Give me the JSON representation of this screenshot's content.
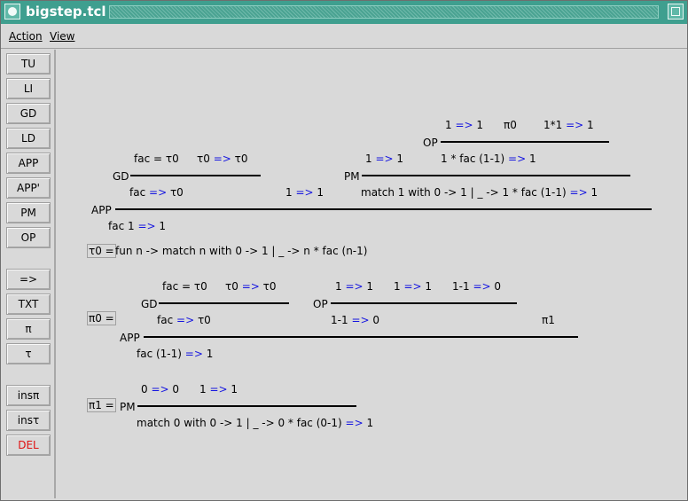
{
  "window": {
    "title": "bigstep.tcl"
  },
  "menu": {
    "action": "Action",
    "view": "View"
  },
  "toolbar": [
    "TU",
    "LI",
    "GD",
    "LD",
    "APP",
    "APP'",
    "PM",
    "OP",
    "=>",
    "TXT",
    "π",
    "τ",
    "insπ",
    "insτ",
    "DEL"
  ],
  "arrow": "=>",
  "main": {
    "op_top": {
      "a": "1",
      "b": "1",
      "pi0": "π0",
      "c": "1*1",
      "d": "1",
      "label": "OP"
    },
    "gd1": {
      "prem1_left": "fac = τ0",
      "prem2_a": "τ0",
      "prem2_b": "τ0",
      "label": "GD",
      "concl_a": "fac",
      "concl_b": "τ0"
    },
    "pm1": {
      "prem1_a": "1",
      "prem1_b": "1",
      "prem2_a": "1 * fac (1-1)",
      "prem2_b": "1",
      "label": "PM",
      "mid_a": "1",
      "mid_b": "1",
      "concl_a": "match 1 with 0 -> 1 | _ -> 1 * fac (1-1)",
      "concl_b": "1"
    },
    "app": {
      "label": "APP",
      "concl_a": "fac 1",
      "concl_b": "1"
    }
  },
  "tau0": {
    "label": "τ0 =",
    "text": "fun n -> match n with 0 -> 1 | _ -> n * fac (n-1)"
  },
  "pi0": {
    "label": "π0 =",
    "gd": {
      "p1": "fac = τ0",
      "p2a": "τ0",
      "p2b": "τ0",
      "label": "GD",
      "ca": "fac",
      "cb": "τ0"
    },
    "op": {
      "p1a": "1",
      "p1b": "1",
      "p2a": "1",
      "p2b": "1",
      "p3a": "1-1",
      "p3b": "0",
      "label": "OP",
      "ca": "1-1",
      "cb": "0"
    },
    "pi1": "π1",
    "app": {
      "label": "APP",
      "ca": "fac (1-1)",
      "cb": "1"
    }
  },
  "pi1": {
    "label": "π1 =",
    "p1a": "0",
    "p1b": "0",
    "p2a": "1",
    "p2b": "1",
    "label_pm": "PM",
    "ca": "match 0 with 0 -> 1 | _ -> 0 * fac (0-1)",
    "cb": "1"
  }
}
